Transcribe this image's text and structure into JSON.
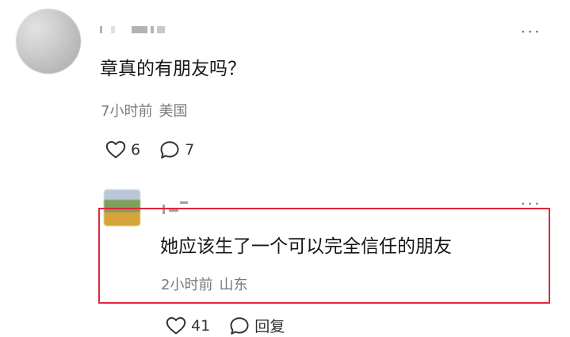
{
  "comments": [
    {
      "text": "章真的有朋友吗？",
      "time": "7小时前",
      "location": "美国",
      "likes": "6",
      "replies": "7"
    }
  ],
  "reply": {
    "text": "她应该生了一个可以完全信任的朋友",
    "time": "2小时前",
    "location": "山东",
    "likes": "41",
    "reply_label": "回复"
  },
  "more_label": "···",
  "colors": {
    "highlight_border": "#e0273a",
    "meta_text": "#7a7a7a"
  }
}
